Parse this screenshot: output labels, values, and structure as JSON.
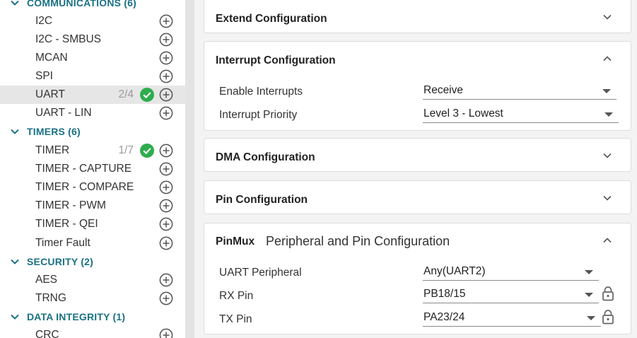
{
  "sidebar": {
    "categories": [
      {
        "label": "COMMUNICATIONS (6)"
      },
      {
        "label": "TIMERS (6)"
      },
      {
        "label": "SECURITY (2)"
      },
      {
        "label": "DATA INTEGRITY (1)"
      }
    ],
    "items": [
      {
        "label": "I2C"
      },
      {
        "label": "I2C - SMBUS"
      },
      {
        "label": "MCAN"
      },
      {
        "label": "SPI"
      },
      {
        "label": "UART",
        "count": "2/4"
      },
      {
        "label": "UART - LIN"
      },
      {
        "label": "TIMER",
        "count": "1/7"
      },
      {
        "label": "TIMER - CAPTURE"
      },
      {
        "label": "TIMER - COMPARE"
      },
      {
        "label": "TIMER - PWM"
      },
      {
        "label": "TIMER - QEI"
      },
      {
        "label": "Timer Fault"
      },
      {
        "label": "AES"
      },
      {
        "label": "TRNG"
      },
      {
        "label": "CRC"
      }
    ],
    "icons": {
      "add": "add-circle-icon",
      "check": "check-circle-icon",
      "collapse": "chevron-down-icon"
    }
  },
  "main": {
    "extend": {
      "title": "Extend Configuration"
    },
    "interrupt": {
      "title": "Interrupt Configuration",
      "rows": [
        {
          "label": "Enable Interrupts",
          "value": "Receive"
        },
        {
          "label": "Interrupt Priority",
          "value": "Level 3 - Lowest"
        }
      ]
    },
    "dma": {
      "title": "DMA Configuration"
    },
    "pin": {
      "title": "Pin Configuration"
    },
    "pinmux": {
      "title": "PinMux",
      "subtitle": "Peripheral and Pin Configuration",
      "rows": [
        {
          "label": "UART Peripheral",
          "value": "Any(UART2)"
        },
        {
          "label": "RX Pin",
          "value": "PB18/15"
        },
        {
          "label": "TX Pin",
          "value": "PA23/24"
        }
      ]
    }
  },
  "colors": {
    "accent": "#1a7186",
    "check": "#2eac4e",
    "selected_bg": "#e6e6e6"
  }
}
